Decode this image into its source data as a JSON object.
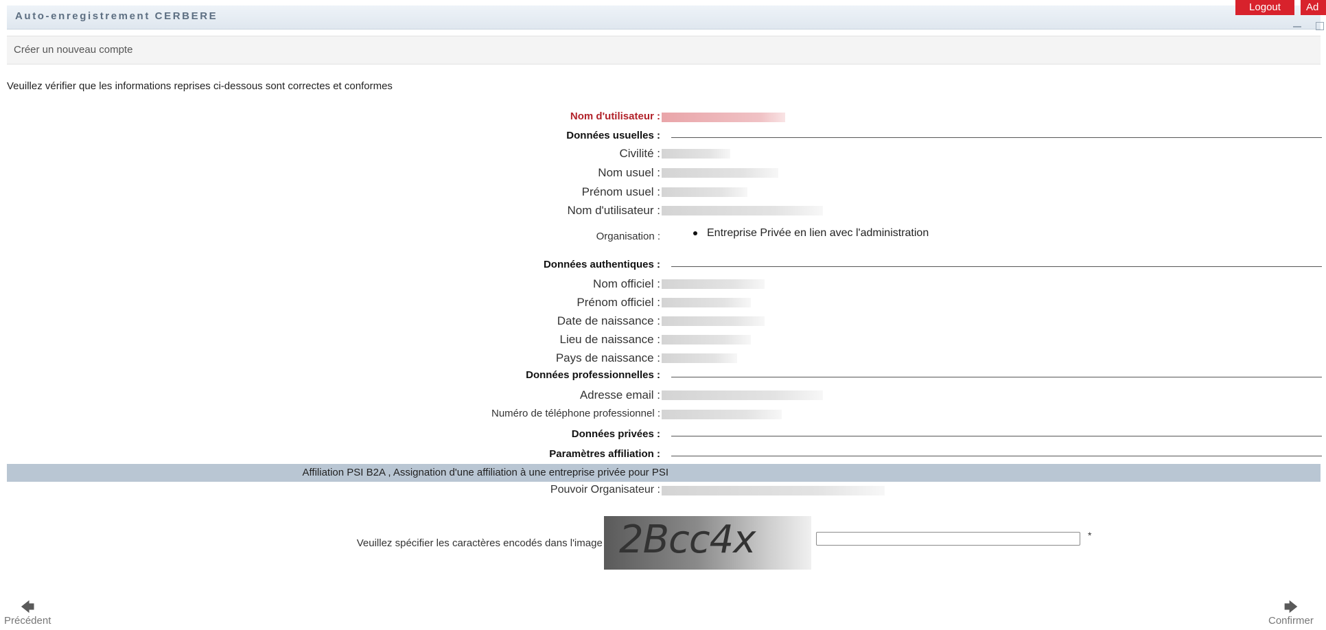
{
  "header": {
    "title": "Auto-enregistrement CERBERE",
    "logout_label": "Logout",
    "second_button_label": "Ad"
  },
  "subheader": {
    "title": "Créer un nouveau compte"
  },
  "intro": "Veuillez vérifier que les informations reprises ci-dessous sont correctes et conformes",
  "username_row": {
    "label": "Nom d'utilisateur :"
  },
  "sections": {
    "usual": "Données usuelles :",
    "authentic": "Données authentiques :",
    "professional": "Données professionnelles :",
    "private": "Données privées :",
    "affiliation": "Paramètres affiliation :"
  },
  "usual_fields": [
    {
      "label": "Civilité :"
    },
    {
      "label": "Nom usuel :"
    },
    {
      "label": "Prénom usuel :"
    },
    {
      "label": "Nom d'utilisateur :"
    }
  ],
  "organisation": {
    "label": "Organisation :",
    "items": [
      "Entreprise Privée en lien avec l'administration"
    ]
  },
  "authentic_fields": [
    {
      "label": "Nom officiel :"
    },
    {
      "label": "Prénom officiel :"
    },
    {
      "label": "Date de naissance :"
    },
    {
      "label": "Lieu de naissance :"
    },
    {
      "label": "Pays de naissance :"
    }
  ],
  "professional_fields": [
    {
      "label": "Adresse email :"
    },
    {
      "label": "Numéro de téléphone professionnel :"
    }
  ],
  "affiliation_bar": "Affiliation PSI B2A , Assignation d'une affiliation à une entreprise privée pour PSI",
  "pouvoir": {
    "label": "Pouvoir Organisateur :"
  },
  "captcha": {
    "label": "Veuillez spécifier les caractères encodés dans l'image ci-dessous :",
    "image_text": "2Bcc4x",
    "value": "",
    "required_mark": "*"
  },
  "navigation": {
    "previous_label": "Précédent",
    "next_label": "Confirmer",
    "previous_icon": "arrow-left-icon",
    "next_icon": "arrow-right-icon"
  },
  "colors": {
    "accent_red": "#d8222c",
    "label_red": "#b2222a",
    "affiliation_bar": "#b9c6d3"
  }
}
